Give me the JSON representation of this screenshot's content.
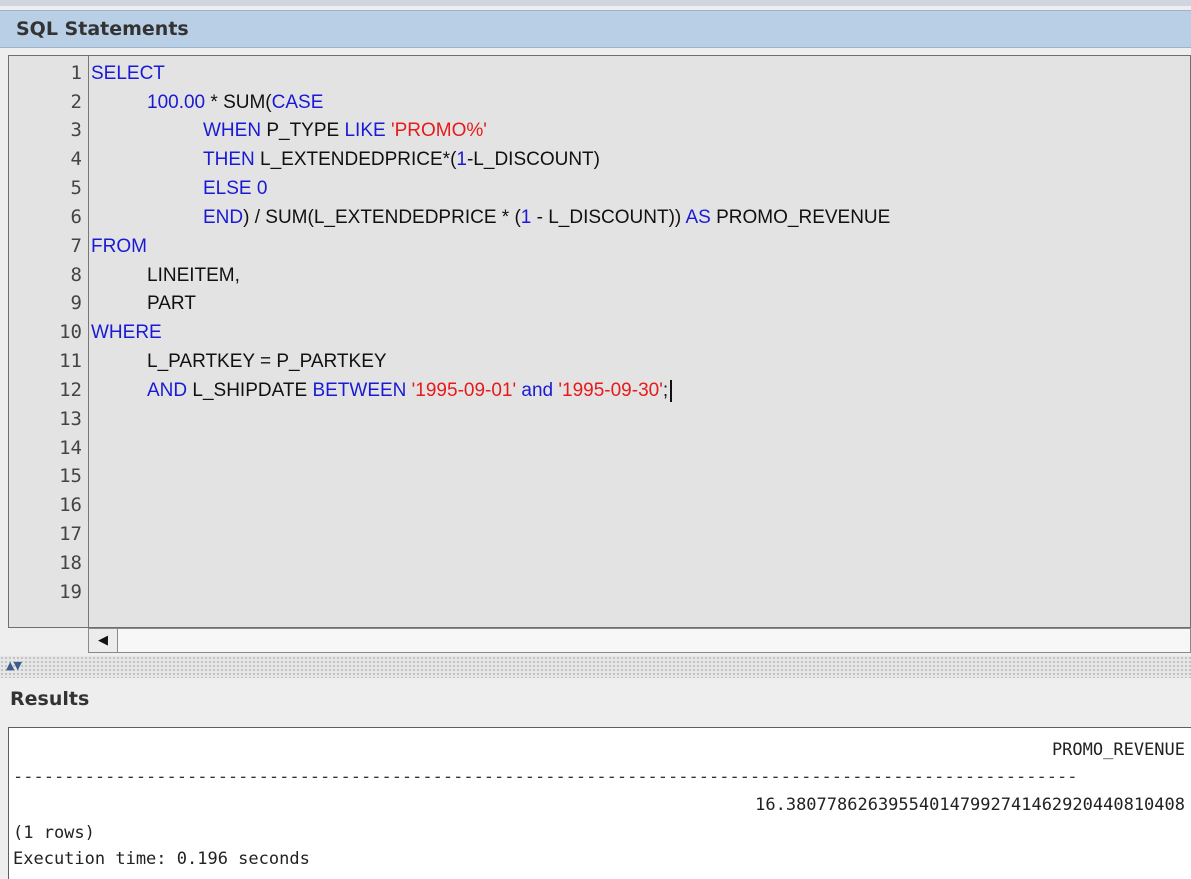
{
  "sql_panel": {
    "title": "SQL Statements"
  },
  "editor": {
    "line_numbers": [
      "1",
      "2",
      "3",
      "4",
      "5",
      "6",
      "7",
      "8",
      "9",
      "10",
      "11",
      "12",
      "13",
      "14",
      "15",
      "16",
      "17",
      "18",
      "19"
    ],
    "code": {
      "l1_kw": "SELECT",
      "l2_num": "100.00",
      "l2_txt": " * SUM(",
      "l2_kw": "CASE",
      "l3_kw1": "WHEN",
      "l3_txt": " P_TYPE ",
      "l3_kw2": "LIKE",
      "l3_sp": " ",
      "l3_str": "'PROMO%'",
      "l4_kw": "THEN",
      "l4_txt1": " L_EXTENDEDPRICE*(",
      "l4_num": "1",
      "l4_txt2": "-L_DISCOUNT)",
      "l5_kw": "ELSE",
      "l5_sp": " ",
      "l5_num": "0",
      "l6_kw1": "END",
      "l6_txt1": ") / SUM(L_EXTENDEDPRICE * (",
      "l6_num": "1",
      "l6_txt2": " - L_DISCOUNT)) ",
      "l6_kw2": "AS",
      "l6_txt3": " PROMO_REVENUE",
      "l7_kw": "FROM",
      "l8_txt": "LINEITEM,",
      "l9_txt": "PART",
      "l10_kw": "WHERE",
      "l11_txt": "L_PARTKEY = P_PARTKEY",
      "l12_kw1": "AND",
      "l12_txt1": " L_SHIPDATE ",
      "l12_kw2": "BETWEEN",
      "l12_sp": " ",
      "l12_str1": "'1995-09-01'",
      "l12_sp2": " ",
      "l12_kw3": "and",
      "l12_sp3": " ",
      "l12_str2": "'1995-09-30'",
      "l12_txt2": ";"
    }
  },
  "scrollbar": {
    "left_arrow": "◀"
  },
  "splitter": {
    "arrows": "▲▼"
  },
  "results_panel": {
    "title": "Results"
  },
  "results": {
    "column_header": "PROMO_REVENUE",
    "separator": "--------------------------------------------------------------------------------------------------------",
    "value": "16.38077862639554014799274146292044081040­8",
    "row_count": "(1 rows)",
    "execution_time": "Execution time: 0.196 seconds"
  },
  "colors": {
    "keyword": "#1a1ad6",
    "string": "#e81a1a",
    "header_bg": "#b8cfe5"
  }
}
